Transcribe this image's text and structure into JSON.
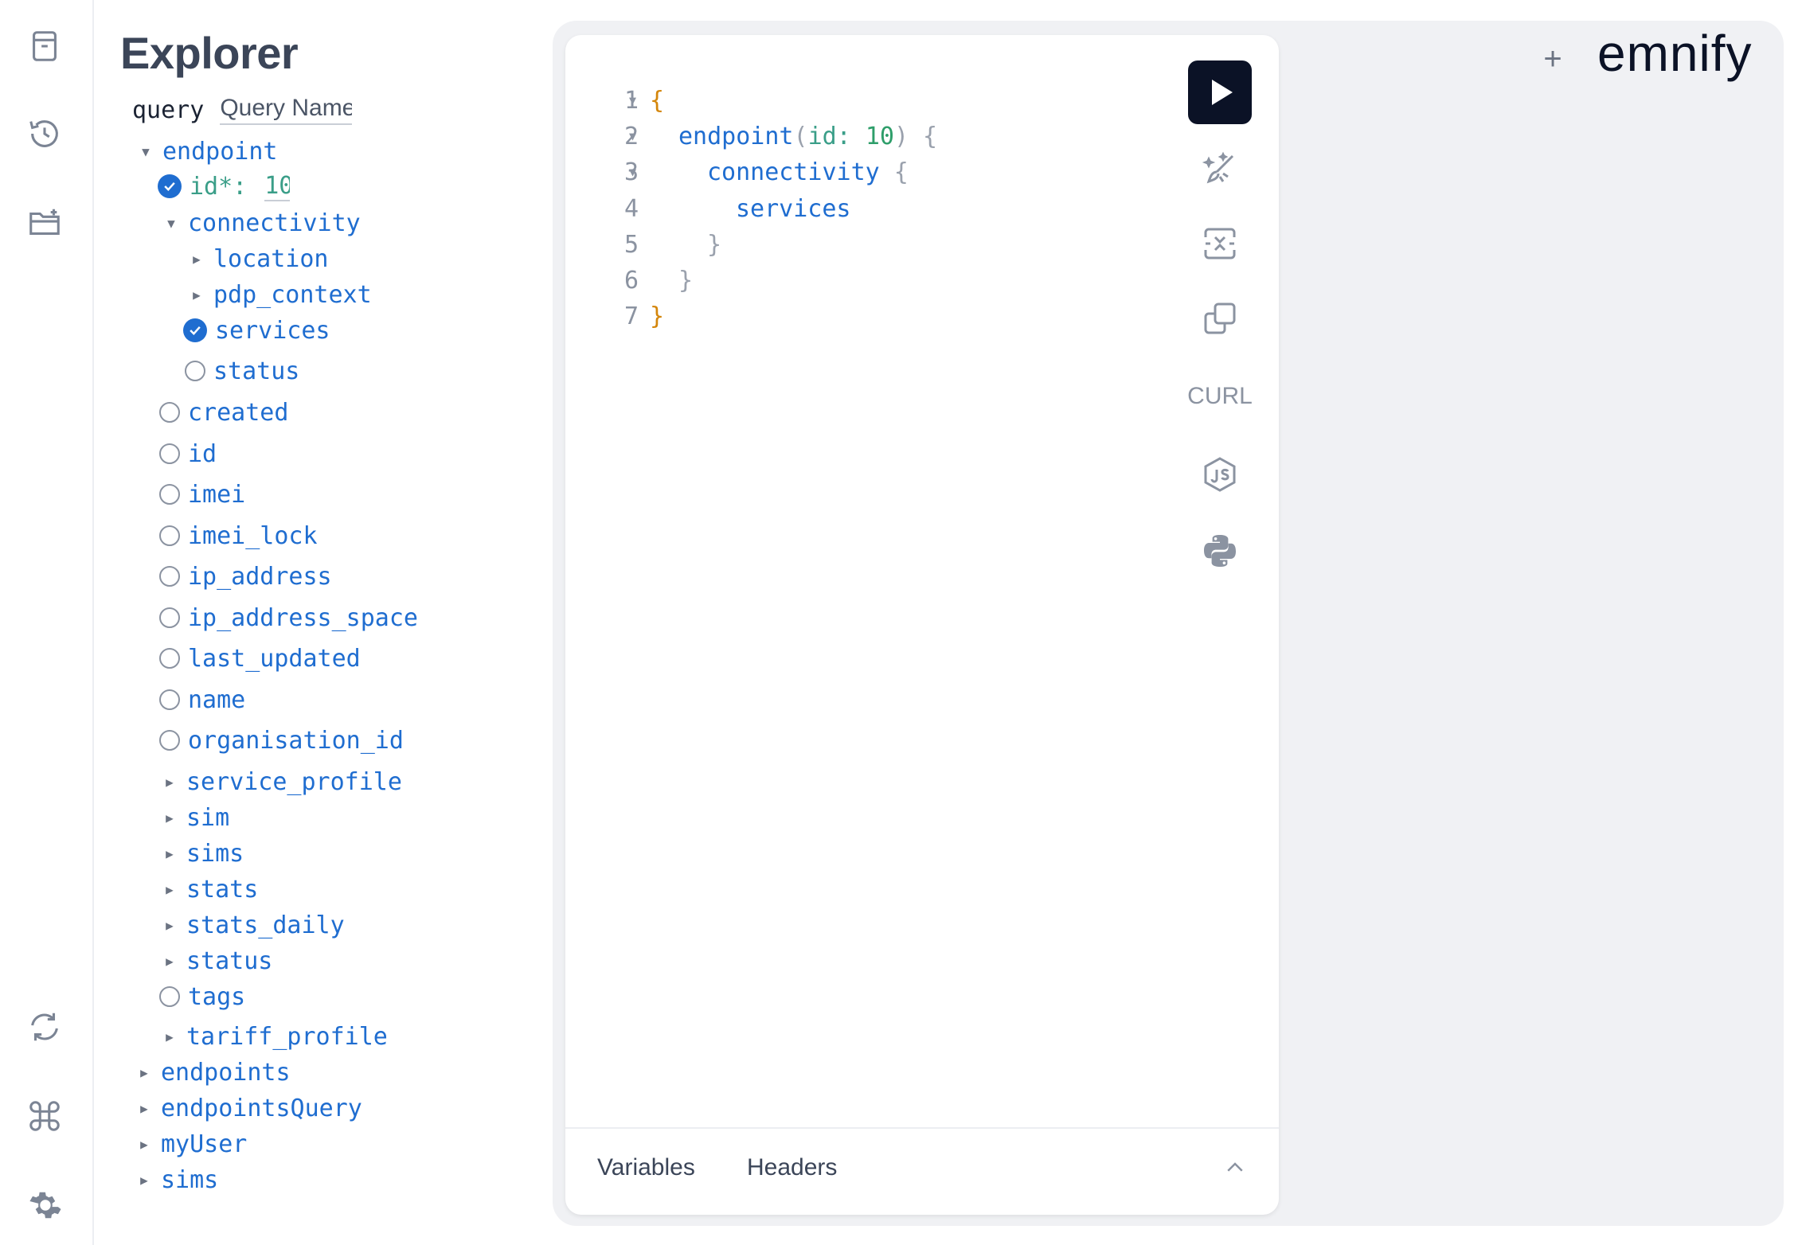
{
  "rail": {
    "icons": [
      "document-icon",
      "history-icon",
      "folder-add-icon",
      "refresh-icon",
      "command-icon",
      "settings-icon"
    ]
  },
  "explorer": {
    "title": "Explorer",
    "operation_keyword": "query",
    "operation_name_placeholder": "Query Name",
    "root": "endpoint",
    "arg_label": "id*:",
    "arg_value": "10",
    "sub": "connectivity",
    "sub_children": [
      "location",
      "pdp_context",
      "services",
      "status"
    ],
    "fields": [
      "created",
      "id",
      "imei",
      "imei_lock",
      "ip_address",
      "ip_address_space",
      "last_updated",
      "name",
      "organisation_id",
      "service_profile",
      "sim",
      "sims",
      "stats",
      "stats_daily",
      "status",
      "tags",
      "tariff_profile"
    ],
    "roots": [
      "endpoints",
      "endpointsQuery",
      "myUser",
      "sims"
    ]
  },
  "editor": {
    "line_numbers": [
      "1",
      "2",
      "3",
      "4",
      "5",
      "6",
      "7"
    ],
    "l1": "{",
    "l2_field": "endpoint",
    "l2_open": "(",
    "l2_arg": "id:",
    "l2_num": "10",
    "l2_close": ") {",
    "l3_field": "connectivity",
    "l3_brace": " {",
    "l4_field": "services",
    "l5": "}",
    "l6": "}",
    "l7": "}"
  },
  "toolbar": {
    "curl_label": "CURL"
  },
  "bottom": {
    "variables_tab": "Variables",
    "headers_tab": "Headers"
  },
  "header": {
    "plus": "+",
    "logo": "emnify"
  },
  "colors": {
    "field": "#1f6dd0",
    "argument": "#3a9e88",
    "brace": "#d4860b",
    "run_button": "#0b1226"
  }
}
